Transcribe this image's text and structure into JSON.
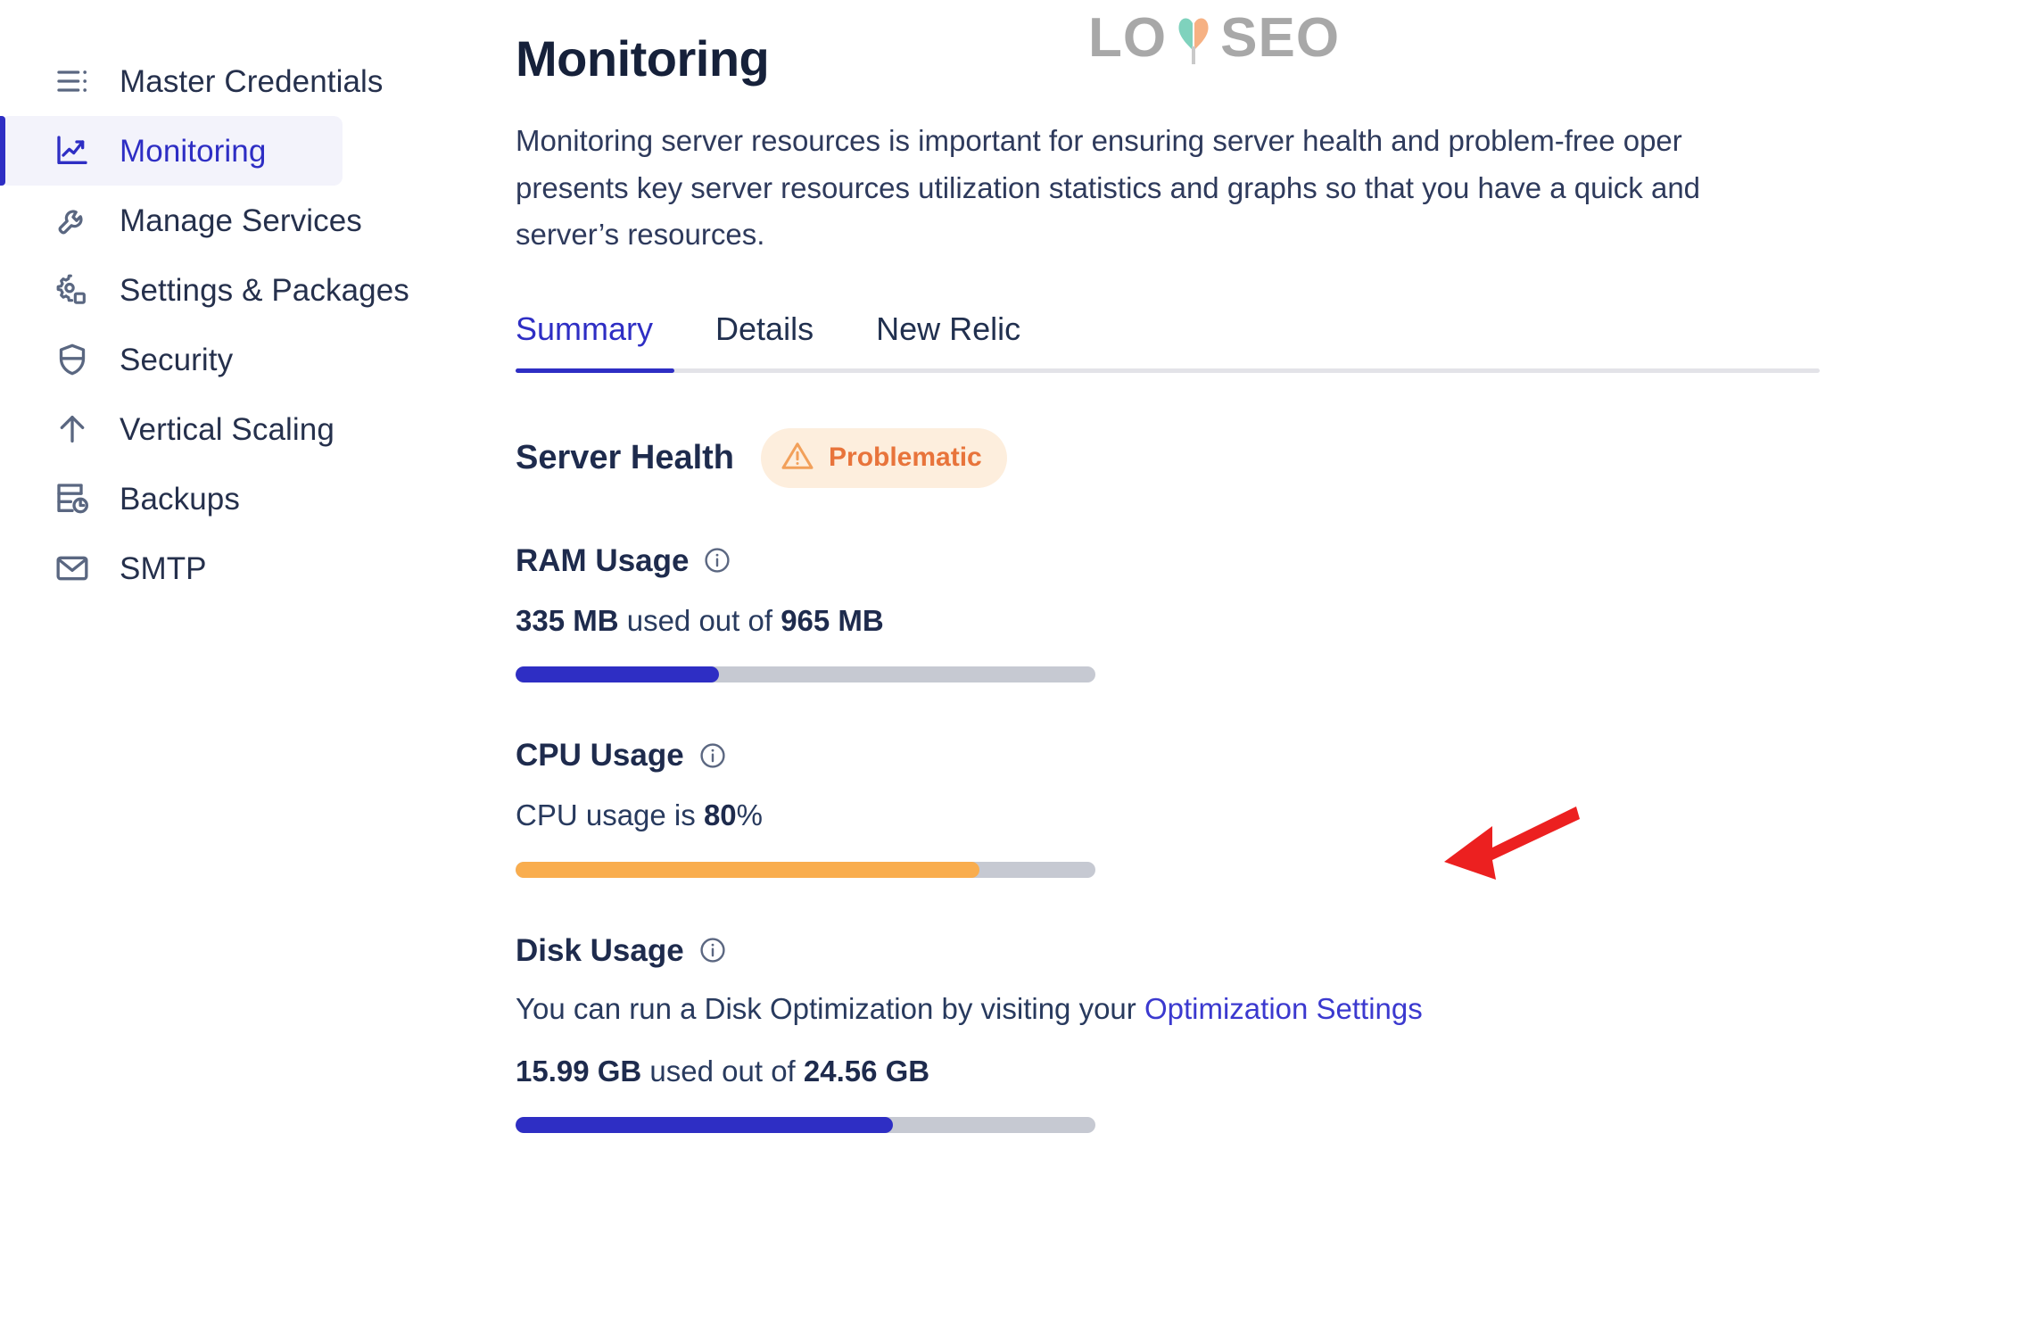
{
  "sidebar": {
    "items": [
      {
        "label": "Master Credentials",
        "icon": "list-menu-icon",
        "active": false
      },
      {
        "label": "Monitoring",
        "icon": "chart-line-icon",
        "active": true
      },
      {
        "label": "Manage Services",
        "icon": "wrench-icon",
        "active": false
      },
      {
        "label": "Settings & Packages",
        "icon": "gear-icon",
        "active": false
      },
      {
        "label": "Security",
        "icon": "shield-icon",
        "active": false
      },
      {
        "label": "Vertical Scaling",
        "icon": "arrow-up-icon",
        "active": false
      },
      {
        "label": "Backups",
        "icon": "backup-icon",
        "active": false
      },
      {
        "label": "SMTP",
        "icon": "envelope-icon",
        "active": false
      }
    ]
  },
  "watermark": {
    "left_text": "LO",
    "right_text": "SEO",
    "heart_left_color": "#7fd2bd",
    "heart_right_color": "#f6b183"
  },
  "header": {
    "title": "Monitoring",
    "description_line1": "Monitoring server resources is important for ensuring server health and problem-free oper",
    "description_line2": "presents key server resources utilization statistics and graphs so that you have a quick and",
    "description_line3": "server’s resources."
  },
  "tabs": {
    "items": [
      {
        "label": "Summary",
        "active": true
      },
      {
        "label": "Details",
        "active": false
      },
      {
        "label": "New Relic",
        "active": false
      }
    ]
  },
  "server_health": {
    "title": "Server Health",
    "badge_label": "Problematic",
    "badge_bg": "#fdeedd",
    "badge_color": "#e8743b",
    "badge_icon": "warning-triangle-icon"
  },
  "metrics": [
    {
      "id": "ram",
      "title": "RAM Usage",
      "info_icon": "info-circle-icon",
      "used": "335 MB",
      "middle_text": " used out of ",
      "total": "965 MB",
      "bar_percent": 35,
      "bar_color": "#2e2ec4"
    },
    {
      "id": "cpu",
      "title": "CPU Usage",
      "info_icon": "info-circle-icon",
      "sentence_prefix": "CPU usage is ",
      "value": "80",
      "sentence_suffix": "%",
      "bar_percent": 80,
      "bar_color": "#f9ad4e"
    },
    {
      "id": "disk",
      "title": "Disk Usage",
      "info_icon": "info-circle-icon",
      "note_prefix": "You can run a Disk Optimization by visiting your ",
      "note_link": "Optimization Settings",
      "used": "15.99 GB",
      "middle_text": " used out of ",
      "total": "24.56 GB",
      "bar_percent": 65,
      "bar_color": "#2e2ec4"
    }
  ],
  "annotation": {
    "arrow_color": "#ec2020",
    "arrow_name": "red-pointer-arrow"
  }
}
